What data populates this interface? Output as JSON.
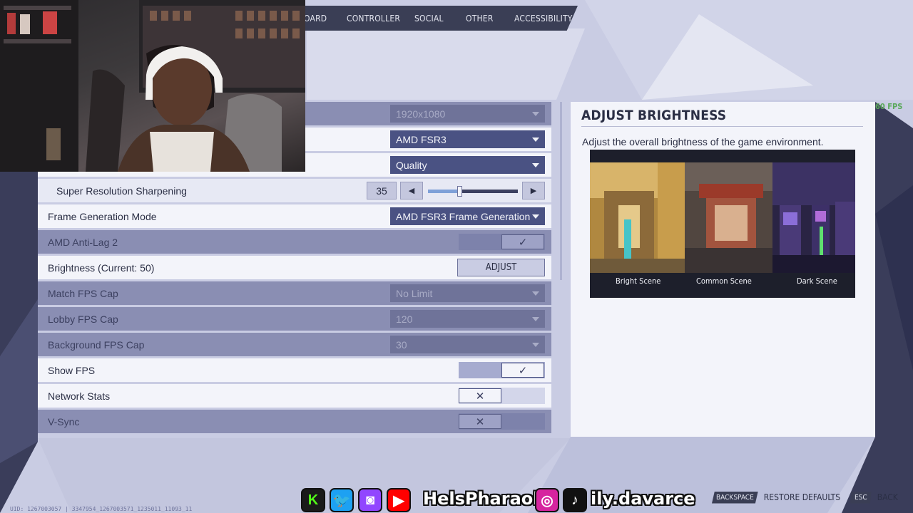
{
  "top_nav": {
    "tabs": [
      {
        "label": "OARD"
      },
      {
        "label": "CONTROLLER"
      },
      {
        "label": "SOCIAL"
      },
      {
        "label": "OTHER"
      },
      {
        "label": "ACCESSIBILITY"
      }
    ]
  },
  "settings": {
    "resolution": {
      "value": "1920x1080"
    },
    "upscaler": {
      "value": "AMD FSR3"
    },
    "quality": {
      "value": "Quality"
    },
    "sharpening": {
      "label": "Super Resolution Sharpening",
      "value": "35",
      "level": 0.35
    },
    "frame_gen": {
      "label": "Frame Generation Mode",
      "value": "AMD FSR3 Frame Generation"
    },
    "anti_lag": {
      "label": "AMD Anti-Lag 2",
      "checked": true
    },
    "brightness": {
      "label": "Brightness (Current: 50)",
      "button": "ADJUST"
    },
    "match_fps": {
      "label": "Match FPS Cap",
      "value": "No Limit"
    },
    "lobby_fps": {
      "label": "Lobby FPS Cap",
      "value": "120"
    },
    "background_fps": {
      "label": "Background FPS Cap",
      "value": "30"
    },
    "show_fps": {
      "label": "Show FPS",
      "checked": true
    },
    "network_stats": {
      "label": "Network Stats",
      "checked": false
    },
    "vsync": {
      "label": "V-Sync",
      "checked": false
    }
  },
  "panel": {
    "title": "ADJUST BRIGHTNESS",
    "description": "Adjust the overall brightness of the game environment.",
    "scenes": [
      {
        "label": "Bright Scene"
      },
      {
        "label": "Common Scene"
      },
      {
        "label": "Dark Scene"
      }
    ]
  },
  "fps_counter": "60 FPS",
  "socials": {
    "handle_1": "HelsPharaoh",
    "handle_2": "ily.davarce"
  },
  "hints": {
    "restore_key": "BACKSPACE",
    "restore_label": "RESTORE DEFAULTS",
    "back_key": "ESC",
    "back_label": "BACK"
  },
  "footer_id": "UID: 1267003057 | 3347954_1267003571_1235011_11093_11",
  "colors": {
    "accent": "#4a5283",
    "panel": "#f3f4fa",
    "dim_row": "#8a8eb3",
    "nav": "#3a3e55",
    "fps_green": "#5ba85b"
  }
}
